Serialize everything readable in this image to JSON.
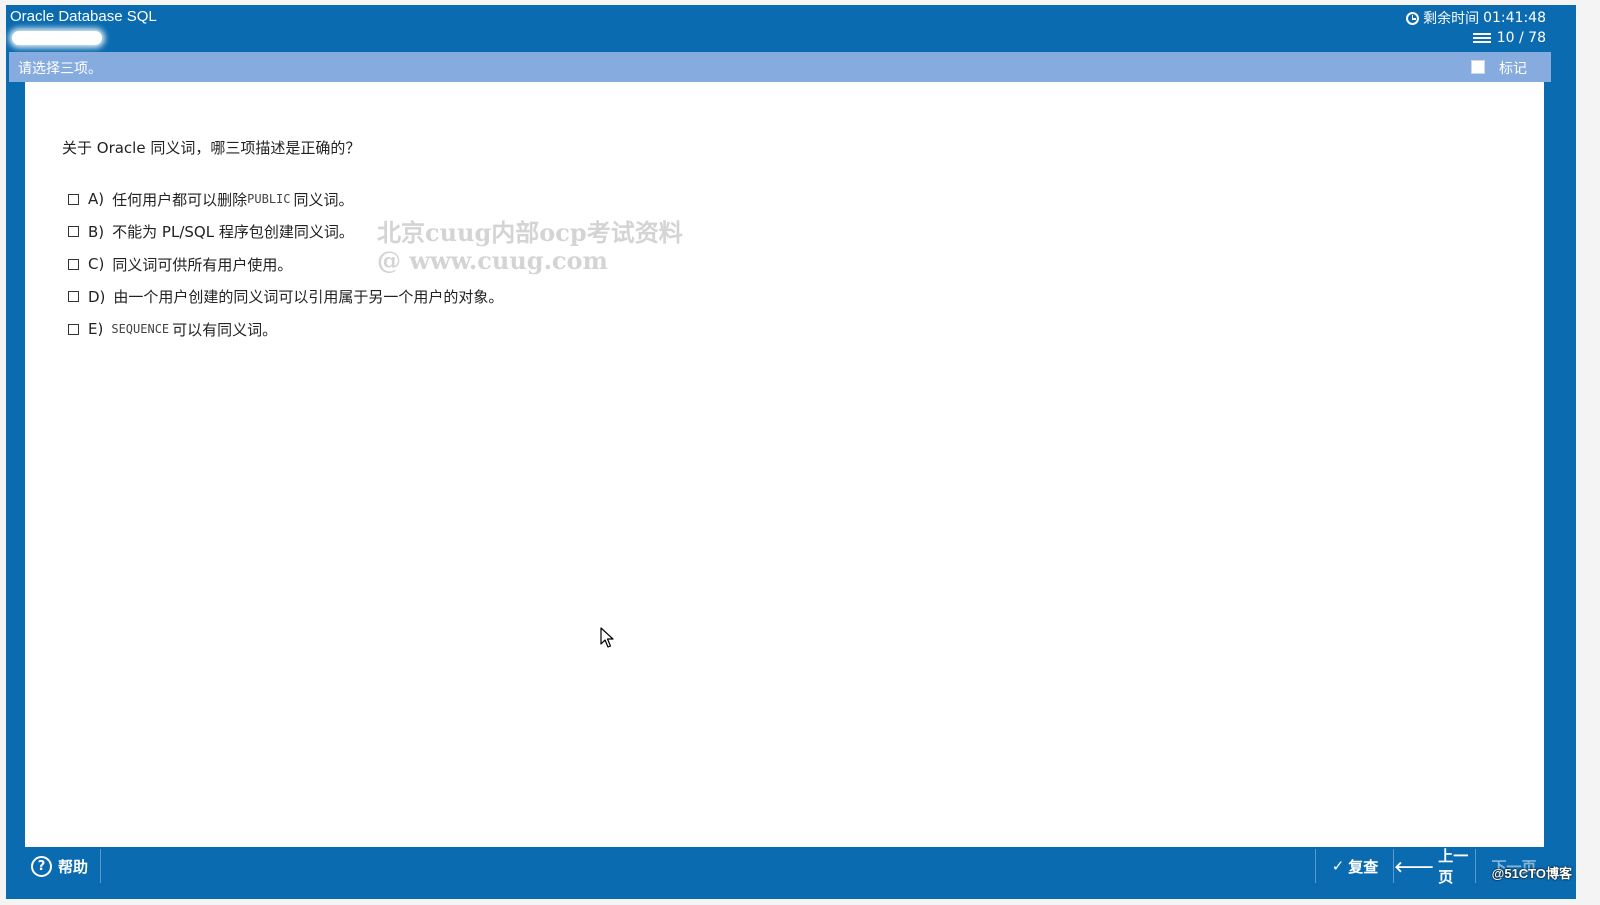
{
  "header": {
    "app_title": "Oracle Database SQL",
    "timer_label": "剩余时间",
    "timer_value": "01:41:48",
    "progress": "10 / 78"
  },
  "instruction": {
    "text": "请选择三项。",
    "mark_label": "标记"
  },
  "question": {
    "text": "关于 Oracle 同义词，哪三项描述是正确的？",
    "options": [
      {
        "letter": "A)",
        "pre": "任何用户都可以删除 ",
        "code": "PUBLIC",
        "post": " 同义词。"
      },
      {
        "letter": "B)",
        "pre": "不能为 PL/SQL 程序包创建同义词。",
        "code": "",
        "post": ""
      },
      {
        "letter": "C)",
        "pre": "同义词可供所有用户使用。",
        "code": "",
        "post": ""
      },
      {
        "letter": "D)",
        "pre": "由一个用户创建的同义词可以引用属于另一个用户的对象。",
        "code": "",
        "post": ""
      },
      {
        "letter": "E)",
        "pre": "",
        "code": "SEQUENCE",
        "post": " 可以有同义词。"
      }
    ]
  },
  "watermark": {
    "line1": "北京cuug内部ocp考试资料",
    "line2": "@ www.cuug.com"
  },
  "footer": {
    "help_label": "帮助",
    "help_glyph": "?",
    "review_label": "复查",
    "review_glyph": "✓",
    "prev_label": "上一页",
    "prev_glyph": "🡐",
    "next_label": "下一页",
    "blog_mark": "@51CTO博客"
  },
  "colors": {
    "frame_blue": "#0a6bb0",
    "instruction_bar": "#86acdf",
    "content_bg": "#ffffff"
  },
  "icons": [
    "clock-icon",
    "list-icon",
    "help-icon",
    "check-icon",
    "arrow-left-icon",
    "mouse-cursor-icon"
  ]
}
